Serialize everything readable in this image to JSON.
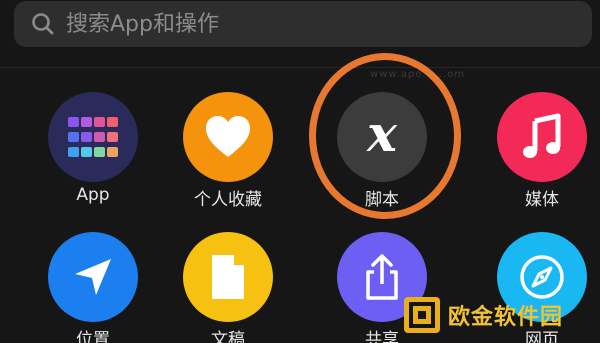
{
  "search": {
    "placeholder": "搜索App和操作"
  },
  "watermark_url": "www.apo......om",
  "apps_row1": [
    {
      "label": "App",
      "icon": "app-grid-icon",
      "color": "#2a2b5a"
    },
    {
      "label": "个人收藏",
      "icon": "heart-icon",
      "color": "#f5930c"
    },
    {
      "label": "脚本",
      "icon": "script-x-icon",
      "color": "#3c3c3c"
    },
    {
      "label": "媒体",
      "icon": "music-note-icon",
      "color": "#f32a58"
    }
  ],
  "apps_row2": [
    {
      "label": "位置",
      "icon": "location-arrow-icon",
      "color": "#1c7ff0"
    },
    {
      "label": "文稿",
      "icon": "document-icon",
      "color": "#f6c110"
    },
    {
      "label": "共享",
      "icon": "share-icon",
      "color": "#6d5ff4"
    },
    {
      "label": "网页",
      "icon": "compass-icon",
      "color": "#19b8f3"
    }
  ],
  "highlight_color": "#e8782f",
  "logo": {
    "text": "欧金软件园",
    "color": "#e9b01c"
  }
}
